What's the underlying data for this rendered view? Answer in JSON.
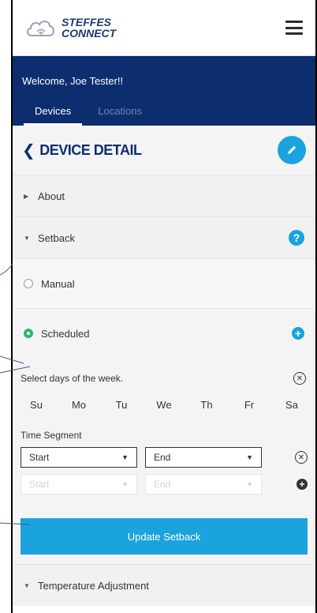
{
  "brand": {
    "line1": "STEFFES",
    "line2": "CONNECT"
  },
  "header": {
    "welcome": "Welcome, Joe Tester!!",
    "tabs": [
      {
        "label": "Devices"
      },
      {
        "label": "Locations"
      }
    ]
  },
  "detail": {
    "title": "DEVICE DETAIL"
  },
  "sections": {
    "about": "About",
    "setback": "Setback",
    "temperature": "Temperature Adjustment"
  },
  "setback": {
    "manual": "Manual",
    "scheduled": "Scheduled",
    "days_prompt": "Select days of the week.",
    "days": [
      "Su",
      "Mo",
      "Tu",
      "We",
      "Th",
      "Fr",
      "Sa"
    ],
    "time_segment": "Time Segment",
    "start_label": "Start",
    "end_label": "End",
    "update_button": "Update Setback"
  },
  "colors": {
    "navy": "#0d2e6e",
    "accent": "#1aa3dd",
    "selected": "#2bb673"
  }
}
